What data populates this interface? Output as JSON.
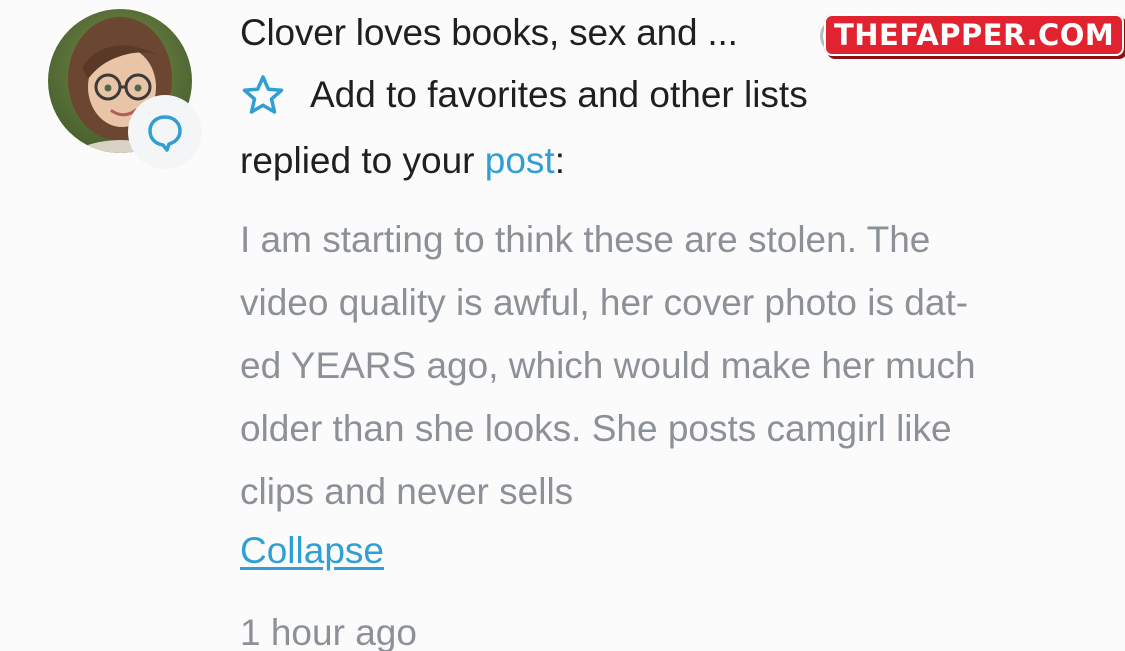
{
  "notification": {
    "username": "Clover loves books, sex and ...",
    "favorites_label": "Add to favorites and other lists",
    "reply_prefix": "replied to your ",
    "post_link": "post",
    "reply_suffix": ":",
    "comment_lines": [
      "I am starting to think these are stolen. The",
      "video quality is awful, her cover photo is dat-",
      "ed YEARS ago, which would make her much",
      "older than she looks. She posts camgirl like",
      "clips and never sells"
    ],
    "collapse_label": "Collapse",
    "timestamp": "1 hour ago"
  },
  "watermark": "THEFAPPER.COM",
  "icons": {
    "favorite": "star-outline-icon",
    "badge": "comment-bubble-icon"
  },
  "colors": {
    "link": "#2f9fd4",
    "body_text": "#8c9197",
    "primary_text": "#1f1f1f",
    "watermark_bg": "#e0232e"
  }
}
